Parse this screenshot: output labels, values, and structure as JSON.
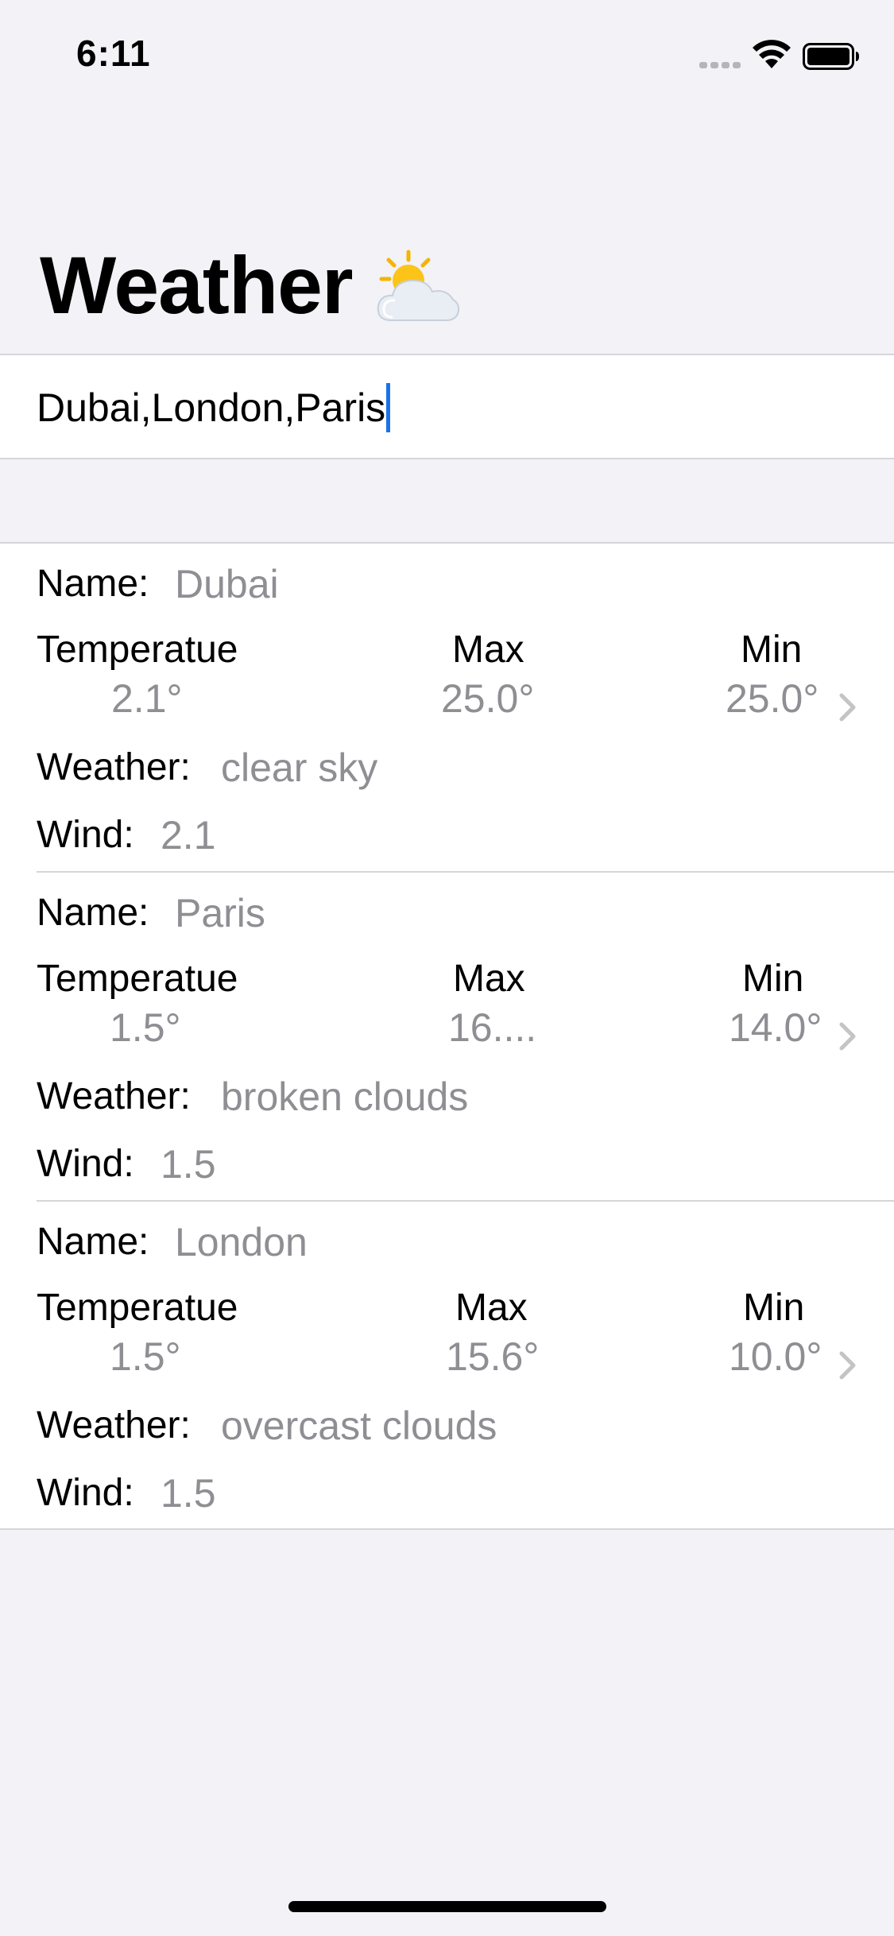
{
  "status_bar": {
    "time": "6:11"
  },
  "header": {
    "title": "Weather",
    "icon": "sun-behind-cloud-icon"
  },
  "search": {
    "value": "Dubai,London,Paris"
  },
  "labels": {
    "name": "Name:",
    "temperature": "Temperatue",
    "max": "Max",
    "min": "Min",
    "weather": "Weather:",
    "wind": "Wind:"
  },
  "cities": [
    {
      "name": "Dubai",
      "temp": "2.1°",
      "max": "25.0°",
      "min": "25.0°",
      "weather": "clear sky",
      "wind": "2.1"
    },
    {
      "name": "Paris",
      "temp": "1.5°",
      "max": "16....",
      "min": "14.0°",
      "weather": "broken clouds",
      "wind": "1.5"
    },
    {
      "name": "London",
      "temp": "1.5°",
      "max": "15.6°",
      "min": "10.0°",
      "weather": "overcast clouds",
      "wind": "1.5"
    }
  ],
  "colors": {
    "background": "#f2f2f7",
    "secondary_text": "#8e8e93",
    "caret": "#1a73e8",
    "separator": "#d6d6da"
  }
}
